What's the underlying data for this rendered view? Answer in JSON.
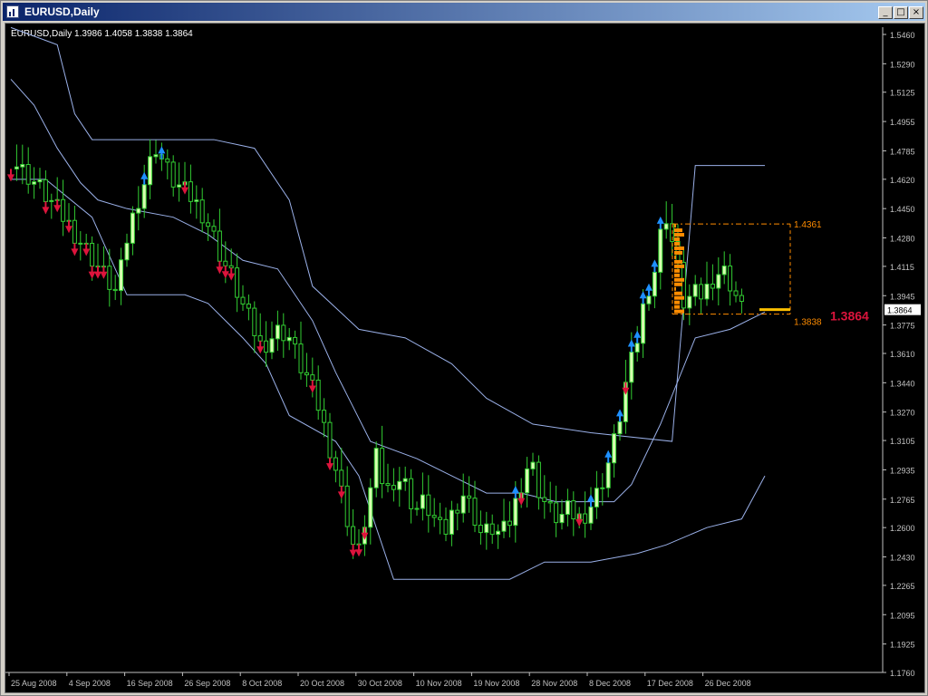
{
  "window": {
    "title": "EURUSD,Daily",
    "controls": {
      "minimize": "_",
      "maximize": "□",
      "close": "×"
    }
  },
  "colors": {
    "background": "#000000",
    "bull_candle": "#d8ffb0",
    "candle_wick": "#32cd32",
    "channel_line": "#9ab0e8",
    "sell_arrow": "#dc143c",
    "buy_arrow": "#1e90ff",
    "orange": "#ff8c00",
    "price_label": "#dc143c",
    "axis": "#c0c0c0"
  },
  "chart_data": {
    "type": "candlestick",
    "symbol": "EURUSD",
    "timeframe": "Daily",
    "header": "EURUSD,Daily  1.3986 1.4058 1.3838 1.3864",
    "ohlc_current": {
      "open": 1.3986,
      "high": 1.4058,
      "low": 1.3838,
      "close": 1.3864
    },
    "y_range": [
      1.176,
      1.546
    ],
    "y_ticks": [
      "1.5460",
      "1.5290",
      "1.5125",
      "1.4955",
      "1.4785",
      "1.4620",
      "1.4450",
      "1.4280",
      "1.4115",
      "1.3945",
      "1.3775",
      "1.3610",
      "1.3440",
      "1.3270",
      "1.3105",
      "1.2935",
      "1.2765",
      "1.2600",
      "1.2430",
      "1.2265",
      "1.2095",
      "1.1925",
      "1.1760"
    ],
    "x_ticks": [
      "25 Aug 2008",
      "4 Sep 2008",
      "16 Sep 2008",
      "26 Sep 2008",
      "8 Oct 2008",
      "20 Oct 2008",
      "30 Oct 2008",
      "10 Nov 2008",
      "19 Nov 2008",
      "28 Nov 2008",
      "8 Dec 2008",
      "17 Dec 2008",
      "26 Dec 2008"
    ],
    "current_price_tag": "1.3864",
    "big_price_label": "1.3864",
    "range_box": {
      "high": 1.4361,
      "low": 1.3838,
      "high_label": "1.4361",
      "low_label": "1.3838"
    },
    "close_anchors": [
      1.474,
      1.468,
      1.463,
      1.457,
      1.45,
      1.443,
      1.436,
      1.428,
      1.42,
      1.412,
      1.404,
      1.395,
      1.426,
      1.447,
      1.462,
      1.482,
      1.47,
      1.46,
      1.455,
      1.45,
      1.442,
      1.43,
      1.415,
      1.405,
      1.39,
      1.378,
      1.365,
      1.37,
      1.375,
      1.37,
      1.355,
      1.345,
      1.33,
      1.31,
      1.29,
      1.265,
      1.24,
      1.27,
      1.3,
      1.28,
      1.29,
      1.285,
      1.27,
      1.275,
      1.265,
      1.255,
      1.27,
      1.28,
      1.27,
      1.255,
      1.26,
      1.255,
      1.265,
      1.285,
      1.3,
      1.28,
      1.27,
      1.265,
      1.27,
      1.265,
      1.27,
      1.28,
      1.295,
      1.315,
      1.345,
      1.365,
      1.395,
      1.41,
      1.445,
      1.42,
      1.39,
      1.395,
      1.395,
      1.405,
      1.41,
      1.4,
      1.3864
    ],
    "channels": {
      "outer_upper": [
        [
          0,
          1.55
        ],
        [
          8,
          1.54
        ],
        [
          11,
          1.5
        ],
        [
          14,
          1.485
        ],
        [
          16,
          1.485
        ],
        [
          20,
          1.485
        ],
        [
          35,
          1.485
        ],
        [
          42,
          1.48
        ],
        [
          48,
          1.45
        ],
        [
          52,
          1.4
        ],
        [
          60,
          1.375
        ],
        [
          68,
          1.37
        ],
        [
          76,
          1.355
        ],
        [
          82,
          1.335
        ],
        [
          90,
          1.32
        ],
        [
          100,
          1.315
        ],
        [
          114,
          1.31
        ],
        [
          118,
          1.47
        ],
        [
          130,
          1.47
        ]
      ],
      "mid_upper": [
        [
          0,
          1.52
        ],
        [
          4,
          1.505
        ],
        [
          8,
          1.48
        ],
        [
          12,
          1.46
        ],
        [
          15,
          1.45
        ],
        [
          20,
          1.445
        ],
        [
          28,
          1.44
        ],
        [
          34,
          1.43
        ],
        [
          40,
          1.415
        ],
        [
          46,
          1.41
        ],
        [
          52,
          1.38
        ],
        [
          56,
          1.35
        ],
        [
          62,
          1.31
        ],
        [
          70,
          1.3
        ],
        [
          76,
          1.29
        ],
        [
          82,
          1.28
        ],
        [
          88,
          1.28
        ],
        [
          94,
          1.275
        ],
        [
          100,
          1.275
        ],
        [
          104,
          1.275
        ],
        [
          107,
          1.285
        ],
        [
          112,
          1.32
        ],
        [
          118,
          1.37
        ],
        [
          124,
          1.375
        ],
        [
          130,
          1.385
        ]
      ],
      "inner_lower": [
        [
          0,
          1.462
        ],
        [
          6,
          1.462
        ],
        [
          14,
          1.44
        ],
        [
          20,
          1.395
        ],
        [
          30,
          1.395
        ],
        [
          34,
          1.39
        ],
        [
          40,
          1.37
        ],
        [
          44,
          1.355
        ],
        [
          48,
          1.325
        ],
        [
          56,
          1.31
        ],
        [
          60,
          1.29
        ],
        [
          66,
          1.23
        ],
        [
          78,
          1.23
        ],
        [
          86,
          1.23
        ],
        [
          92,
          1.24
        ],
        [
          100,
          1.24
        ],
        [
          108,
          1.245
        ],
        [
          113,
          1.25
        ],
        [
          120,
          1.26
        ],
        [
          126,
          1.265
        ],
        [
          130,
          1.29
        ]
      ]
    },
    "sell_arrows": [
      0,
      6,
      8,
      10,
      11,
      13,
      14,
      15,
      16,
      30,
      36,
      37,
      38,
      43,
      52,
      55,
      57,
      59,
      60,
      61,
      88,
      98,
      106
    ],
    "buy_arrows": [
      23,
      26,
      87,
      100,
      103,
      105,
      107,
      108,
      109,
      110,
      111,
      112
    ]
  }
}
